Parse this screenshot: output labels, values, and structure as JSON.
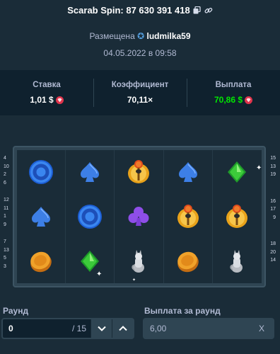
{
  "header": {
    "title": "Scarab Spin: 87 630 391 418",
    "placed_prefix": "Размещена",
    "username": "ludmilka59",
    "date": "04.05.2022 в 09:58"
  },
  "stats": {
    "bet_label": "Ставка",
    "bet_value": "1,01 $",
    "multiplier_label": "Коэффициент",
    "multiplier_value": "70,11×",
    "payout_label": "Выплата",
    "payout_value": "70,86 $"
  },
  "paylines": {
    "left": [
      "4",
      "10",
      "2",
      "6",
      "",
      "12",
      "11",
      "1",
      "9",
      "",
      "7",
      "13",
      "5",
      "3"
    ],
    "right": [
      "15",
      "13",
      "19",
      "",
      "16",
      "17",
      "9",
      "",
      "18",
      "20",
      "14"
    ]
  },
  "reels": [
    [
      "blue-ring",
      "spade",
      "scarab",
      "spade",
      "diamond"
    ],
    [
      "spade",
      "blue-ring",
      "club",
      "scarab",
      "scarab"
    ],
    [
      "coin",
      "diamond",
      "cat",
      "coin",
      "cat"
    ]
  ],
  "round": {
    "label": "Раунд",
    "value": "0",
    "total": "/ 15"
  },
  "round_payout": {
    "label": "Выплата за раунд",
    "value": "6,00",
    "clear": "X"
  },
  "colors": {
    "background": "#1a2c38",
    "panel": "#0f212e",
    "green": "#00e701",
    "gem": "#e0344c"
  }
}
